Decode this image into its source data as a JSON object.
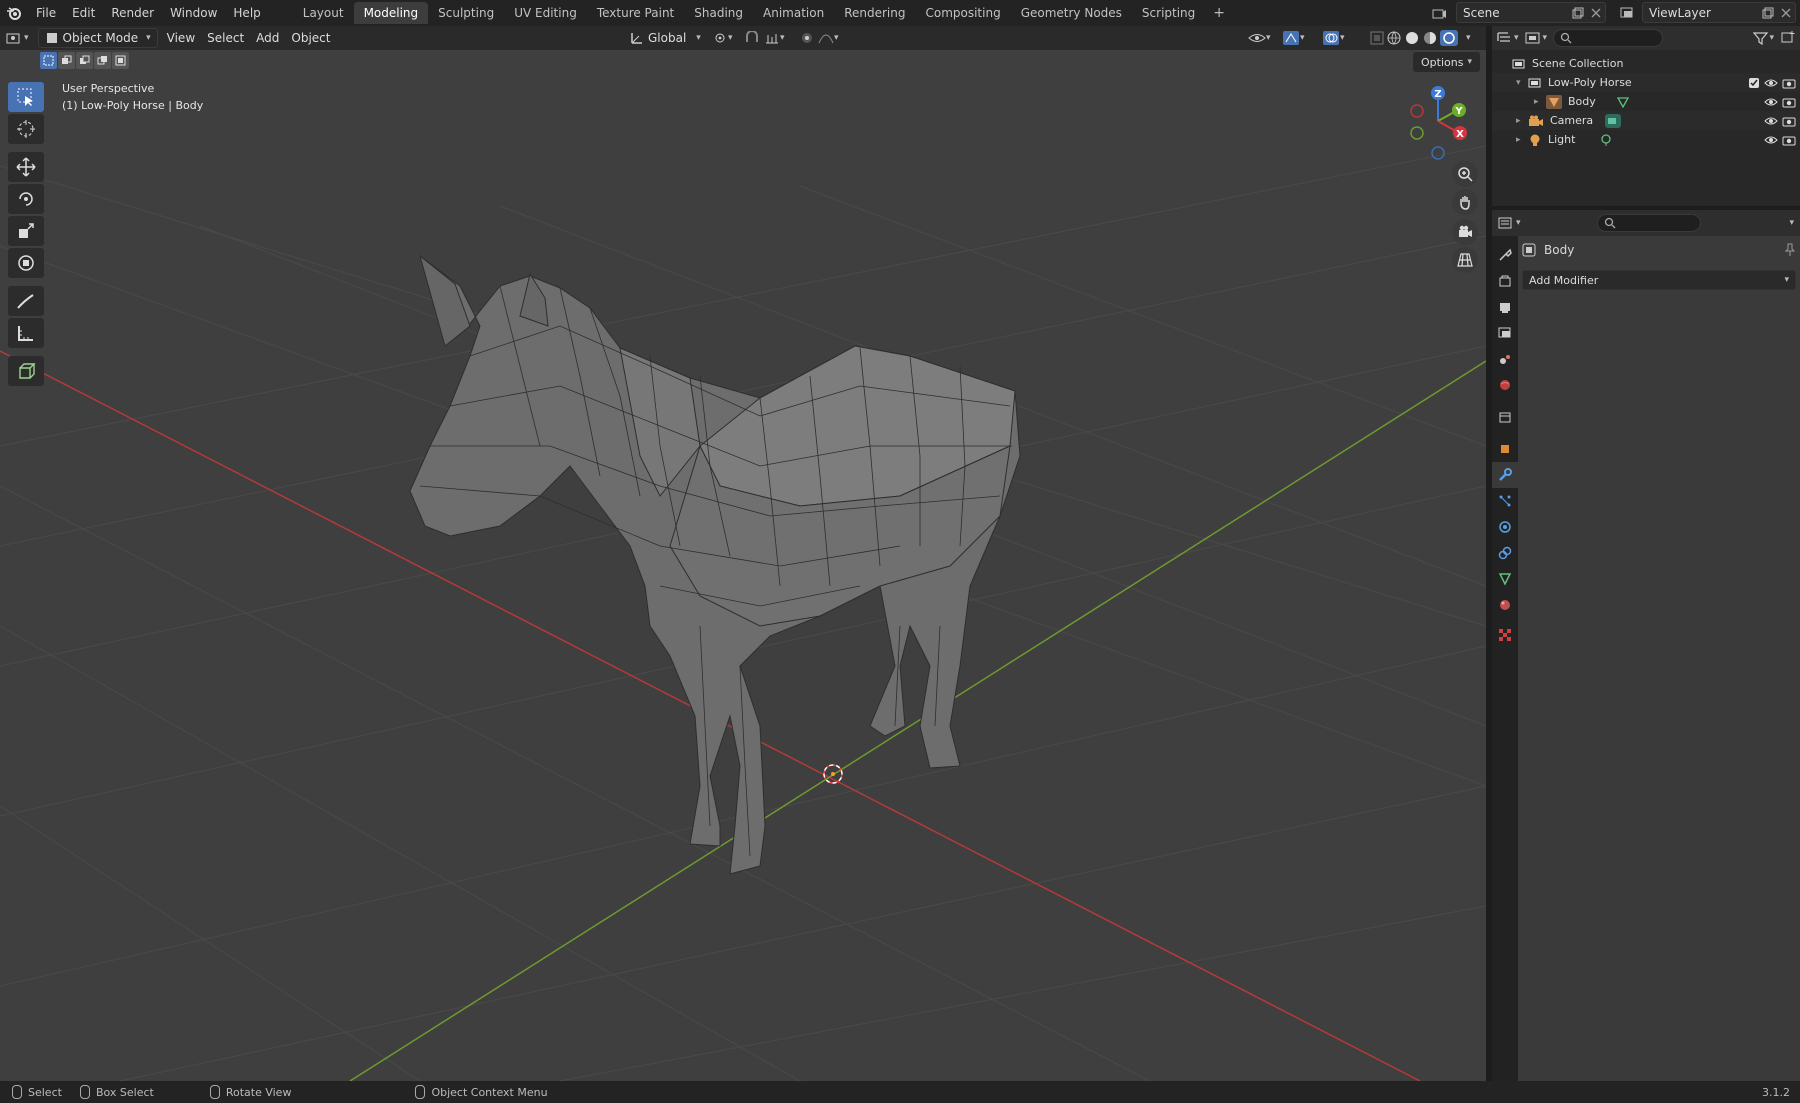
{
  "topbar": {
    "menus": [
      "File",
      "Edit",
      "Render",
      "Window",
      "Help"
    ],
    "workspaces": [
      "Layout",
      "Modeling",
      "Sculpting",
      "UV Editing",
      "Texture Paint",
      "Shading",
      "Animation",
      "Rendering",
      "Compositing",
      "Geometry Nodes",
      "Scripting"
    ],
    "active_workspace": "Modeling",
    "scene": "Scene",
    "view_layer": "ViewLayer"
  },
  "viewport_header": {
    "mode": "Object Mode",
    "menus": [
      "View",
      "Select",
      "Add",
      "Object"
    ],
    "transform_orientation": "Global",
    "options_label": "Options"
  },
  "viewport": {
    "perspective_label": "User Perspective",
    "object_label": "(1) Low-Poly Horse | Body",
    "gizmo_axes": {
      "x": "X",
      "y": "Y",
      "z": "Z"
    },
    "colors": {
      "background": "#3f3f3f",
      "x_axis": "#b43a3a",
      "y_axis": "#6f9a2f",
      "accent": "#4772b3"
    }
  },
  "toolbar": {
    "tools": [
      "select-box",
      "cursor",
      "move",
      "rotate",
      "scale",
      "transform",
      "annotate",
      "measure",
      "add-cube"
    ],
    "active_tool": "select-box"
  },
  "outliner": {
    "search_placeholder": "",
    "rows": [
      {
        "label": "Scene Collection",
        "icon": "collection-icon"
      },
      {
        "label": "Low-Poly Horse",
        "icon": "collection-icon"
      },
      {
        "label": "Body",
        "icon": "mesh-icon"
      },
      {
        "label": "Camera",
        "icon": "camera-icon"
      },
      {
        "label": "Light",
        "icon": "light-icon"
      }
    ]
  },
  "properties": {
    "object_name": "Body",
    "add_modifier_label": "Add Modifier",
    "tabs": [
      "tool",
      "render",
      "output",
      "view-layer",
      "scene",
      "world",
      "collection",
      "object",
      "modifiers",
      "particles",
      "physics",
      "constraints",
      "data",
      "material",
      "texture"
    ],
    "active_tab": "modifiers"
  },
  "statusbar": {
    "items": [
      "Select",
      "Box Select",
      "Rotate View",
      "Object Context Menu"
    ],
    "version": "3.1.2"
  }
}
